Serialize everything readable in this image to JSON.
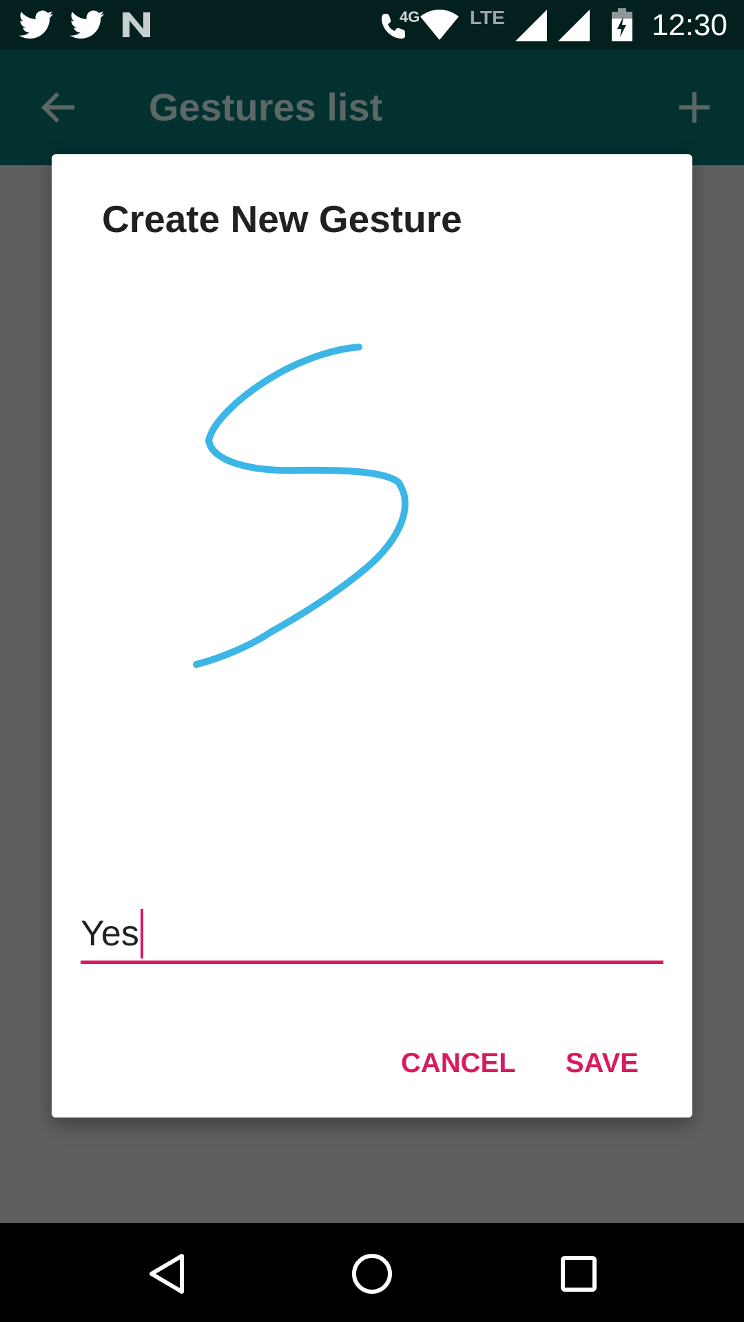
{
  "status_bar": {
    "time": "12:30",
    "network_4g": "4G",
    "network_lte": "LTE",
    "icons": [
      "twitter-icon",
      "twitter-icon",
      "n-notification-icon",
      "wifi-call-icon",
      "wifi-icon",
      "signal-icon",
      "signal-icon",
      "battery-charging-icon"
    ]
  },
  "toolbar": {
    "title": "Gestures list",
    "back_icon": "arrow-back-icon",
    "add_icon": "plus-icon"
  },
  "dialog": {
    "title": "Create New Gesture",
    "gesture_name_value": "Yes",
    "cancel_label": "CANCEL",
    "save_label": "SAVE",
    "gesture_stroke_color": "#3bb6e6",
    "accent_color": "#d81b60"
  },
  "nav_bar": {
    "icons": [
      "back-triangle-icon",
      "home-circle-icon",
      "recents-square-icon"
    ]
  }
}
